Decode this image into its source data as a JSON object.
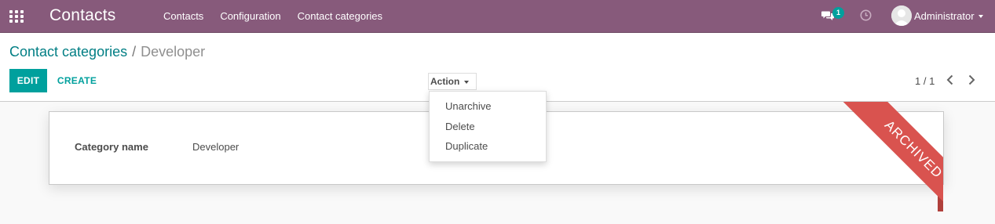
{
  "app": {
    "title": "Contacts"
  },
  "navbar": {
    "menu": [
      "Contacts",
      "Configuration",
      "Contact categories"
    ],
    "message_count": "1",
    "user_name": "Administrator"
  },
  "breadcrumb": {
    "parent": "Contact categories",
    "separator": "/",
    "current": "Developer"
  },
  "buttons": {
    "edit": "EDIT",
    "create": "CREATE",
    "action": "Action"
  },
  "pager": {
    "value": "1 / 1"
  },
  "action_menu": {
    "items": [
      "Unarchive",
      "Delete",
      "Duplicate"
    ]
  },
  "form": {
    "field_label": "Category name",
    "field_value": "Developer"
  },
  "ribbon": {
    "text": "ARCHIVED",
    "color": "#d9534f"
  },
  "colors": {
    "brand": "#875a7b",
    "accent": "#00a09d",
    "link": "#017e84"
  }
}
